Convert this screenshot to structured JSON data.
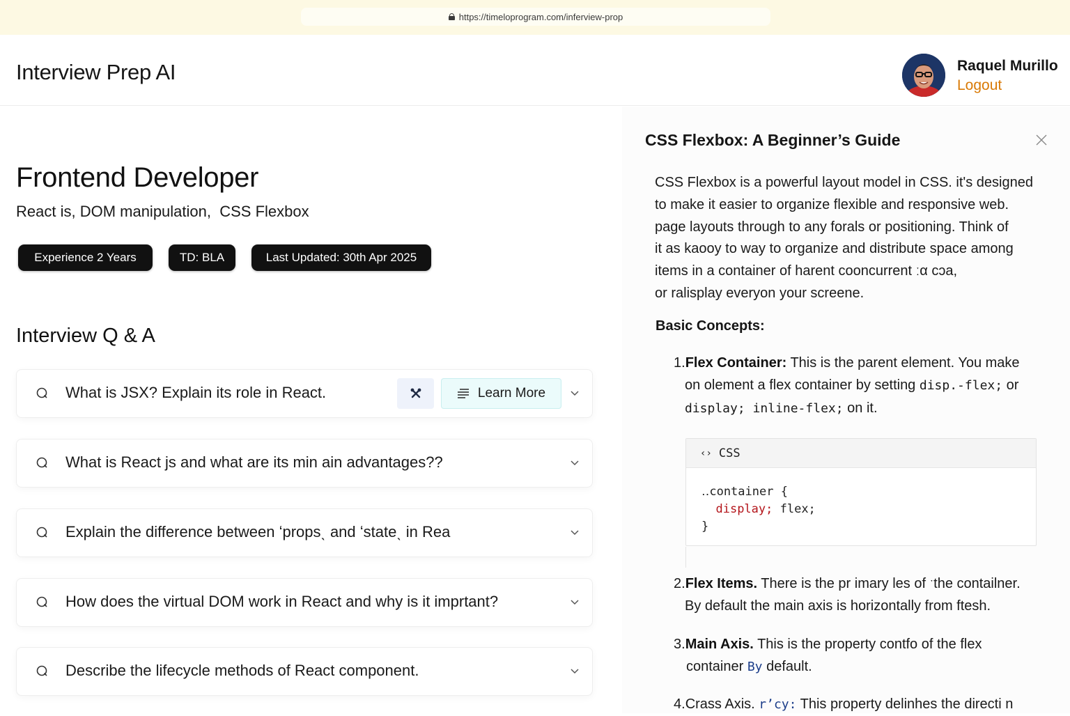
{
  "browser": {
    "url": "https://timeloprogram.com/inferview-prop"
  },
  "header": {
    "app_title": "Interview Prep AI",
    "user_name": "Raquel Murillo",
    "logout_label": "Logout"
  },
  "role": {
    "title": "Frontend Developer",
    "topics": "React is, DOM manipulation,  CSS Flexbox",
    "pills": [
      "Experience 2 Years",
      "TD: BLA",
      "Last Updated: 30th Apr 2025"
    ]
  },
  "qa": {
    "section_title": "Interview Q & A",
    "learn_more_label": "Learn More",
    "questions": [
      "What is JSX? Explain its role in React.",
      "What is React js and what are its min ain advantages??",
      "Explain the difference between ʻpropsˎ and ʻstateˎ in Rea",
      "How does the virtual DOM work in React and why is it imprtant?",
      "Describe the lifecycle methods of React component."
    ]
  },
  "panel": {
    "title": "CSS Flexbox: A Beginner’s Guide",
    "intro": "CSS Flexbox is a powerful layout model in CSS. it's designed\nto make it easier to organize flexible and responsive web.\npage layouts through to any forals or positioning. Think of\nit as kaooy to way to organize and distribute space among\nitems in a container of harent cooncurrent ːα cɔa,\nor ralisplay everyon your screene.",
    "basic_heading": "Basic Concepts:",
    "items": [
      {
        "num": "1.",
        "bold": "Flex Container:",
        "text1": " This is the parent element. You make",
        "text2a": "on olement a flex container by setting ",
        "code1": "disp.-flex;",
        "text2b": " or",
        "code2": "display; inline-flex;",
        "text3": " on it."
      },
      {
        "num": "2.",
        "bold": "Flex Items.",
        "text1": " There is the pr imary les of ˑthe contailner.",
        "text2": "By default the main axis is horizontally from ftesh."
      },
      {
        "num": "3.",
        "bold": "Main Axis.",
        "text1": " This is the property contfo of the flex",
        "text2a": "container ",
        "code": "By",
        "text2b": " default."
      },
      {
        "num": "4.",
        "lead": "Crass Axis. ",
        "code": "rʼcy:",
        "text1": " This property delinhes the directi n"
      }
    ],
    "code_block": {
      "language": "CSS",
      "line1": "‥container {",
      "prop": "display;",
      "value": " flex;",
      "line3": "}"
    }
  }
}
